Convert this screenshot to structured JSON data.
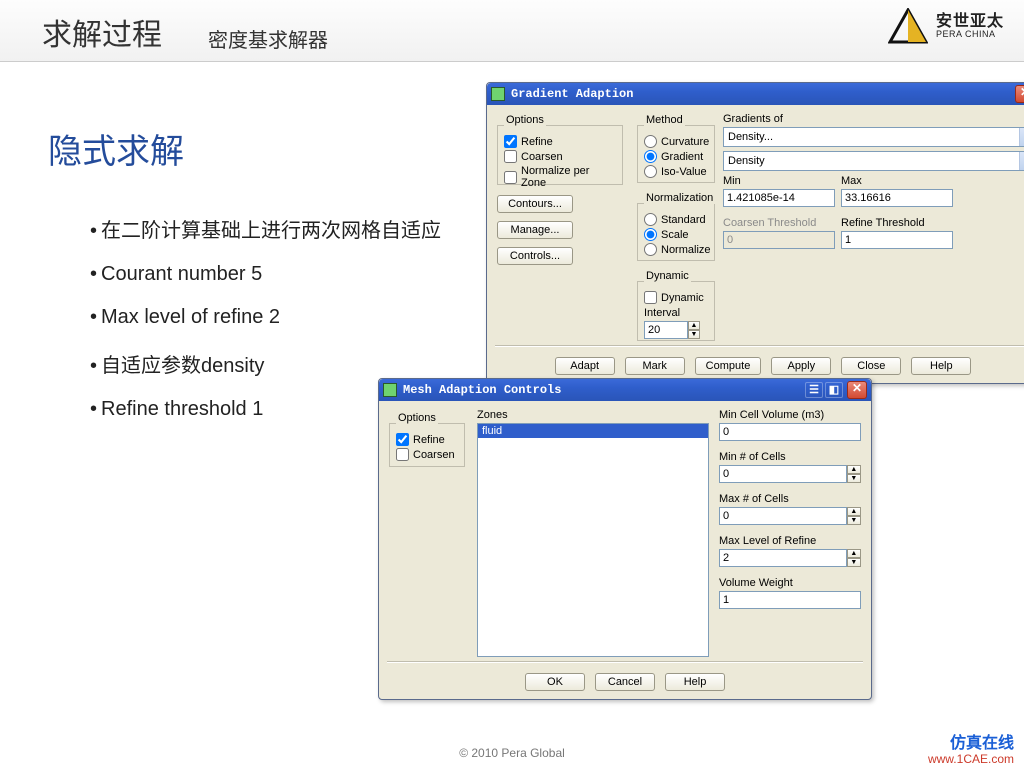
{
  "header": {
    "title": "求解过程",
    "subtitle": "密度基求解器",
    "logo_cn": "安世亚太",
    "logo_en": "PERA CHINA"
  },
  "body": {
    "heading": "隐式求解",
    "bullets": [
      "在二阶计算基础上进行两次网格自适应",
      "Courant number 5",
      "Max level of refine 2",
      "自适应参数density",
      "Refine threshold 1"
    ]
  },
  "dialog1": {
    "title": "Gradient Adaption",
    "options_label": "Options",
    "options": {
      "refine": "Refine",
      "coarsen": "Coarsen",
      "normalize_per_zone": "Normalize per Zone"
    },
    "options_checked": {
      "refine": true,
      "coarsen": false,
      "normalize_per_zone": false
    },
    "method_label": "Method",
    "method": {
      "curvature": "Curvature",
      "gradient": "Gradient",
      "iso_value": "Iso-Value"
    },
    "method_selected": "gradient",
    "normalization_label": "Normalization",
    "normalization": {
      "standard": "Standard",
      "scale": "Scale",
      "normalize": "Normalize"
    },
    "normalization_selected": "scale",
    "dynamic_label": "Dynamic",
    "dynamic": {
      "dynamic_checkbox": "Dynamic",
      "interval_label": "Interval",
      "interval_value": "20"
    },
    "gradients_of_label": "Gradients of",
    "gradients_of_combo1": "Density...",
    "gradients_of_combo2": "Density",
    "min_label": "Min",
    "max_label": "Max",
    "min_value": "1.421085e-14",
    "max_value": "33.16616",
    "coarsen_threshold_label": "Coarsen Threshold",
    "refine_threshold_label": "Refine Threshold",
    "coarsen_threshold_value": "0",
    "refine_threshold_value": "1",
    "side_buttons": {
      "contours": "Contours...",
      "manage": "Manage...",
      "controls": "Controls..."
    },
    "buttons": {
      "adapt": "Adapt",
      "mark": "Mark",
      "compute": "Compute",
      "apply": "Apply",
      "close": "Close",
      "help": "Help"
    }
  },
  "dialog2": {
    "title": "Mesh Adaption Controls",
    "options_label": "Options",
    "options": {
      "refine": "Refine",
      "coarsen": "Coarsen"
    },
    "options_checked": {
      "refine": true,
      "coarsen": false
    },
    "zones_label": "Zones",
    "zones": [
      "fluid"
    ],
    "zones_selected": "fluid",
    "fields": {
      "min_cell_volume": {
        "label": "Min Cell Volume (m3)",
        "value": "0"
      },
      "min_cells": {
        "label": "Min # of Cells",
        "value": "0"
      },
      "max_cells": {
        "label": "Max # of Cells",
        "value": "0"
      },
      "max_level_refine": {
        "label": "Max Level of Refine",
        "value": "2"
      },
      "volume_weight": {
        "label": "Volume Weight",
        "value": "1"
      }
    },
    "buttons": {
      "ok": "OK",
      "cancel": "Cancel",
      "help": "Help"
    }
  },
  "footer": "© 2010 Pera Global",
  "watermark": {
    "line1": "仿真在线",
    "line2": "www.1CAE.com"
  }
}
